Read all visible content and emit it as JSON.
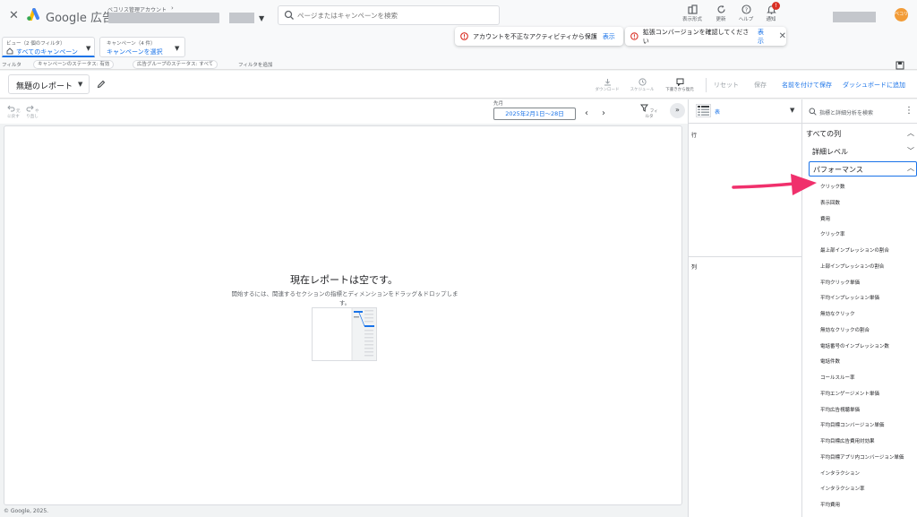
{
  "topbar": {
    "brand": "Google 広告",
    "account_label": "ベコリス管理アカウント",
    "search_placeholder": "ページまたはキャンペーンを検索",
    "tools": {
      "view_mode": "表示形式",
      "refresh": "更新",
      "help": "ヘルプ",
      "notifications": "通知",
      "notification_count": "!"
    },
    "avatar_text": "ベコリス"
  },
  "view_selector": {
    "small": "ビュー（2 個のフィルタ）",
    "main": "すべてのキャンペーン"
  },
  "campaign_selector": {
    "small": "キャンペーン（4 件）",
    "main": "キャンペーンを選択"
  },
  "toasts": [
    {
      "text": "アカウントを不正なアクティビティから保護",
      "link": "表示"
    },
    {
      "text": "拡張コンバージョンを確認してください",
      "link": "表示"
    }
  ],
  "filters": {
    "label": "フィルタ",
    "chips": [
      "キャンペーンのステータス: 有効",
      "広告グループのステータス: すべて"
    ],
    "add": "フィルタを追加"
  },
  "report": {
    "title": "無題のレポート",
    "tools": [
      "ダウンロード",
      "スケジュール",
      "下書きから復元"
    ],
    "reset": "リセット",
    "save": "保存",
    "save_as": "名前を付けて保存",
    "add_to_dashboard": "ダッシュボードに追加"
  },
  "canvas_toolbar": {
    "undo": "元に戻す",
    "redo": "やり直し",
    "period_label": "先月",
    "date_range": "2025年2月1日〜28日",
    "filter": "フィルタ"
  },
  "canvas": {
    "empty_title": "現在レポートは空です。",
    "empty_desc": "開始するには、関連するセクションの指標とディメンションをドラッグ＆ドロップします。"
  },
  "footer": "© Google, 2025.",
  "mid_panel": {
    "visualization": "表",
    "rows_label": "行",
    "columns_label": "列"
  },
  "right_panel": {
    "search_placeholder": "指標と詳細分析を検索",
    "sections": {
      "all_columns": "すべての列",
      "detail_level": "詳細レベル",
      "performance": "パフォーマンス"
    },
    "metrics": [
      "クリック数",
      "表示回数",
      "費用",
      "クリック率",
      "最上部インプレッションの割合",
      "上部インプレッションの割合",
      "平均クリック単価",
      "平均インプレッション単価",
      "無効なクリック",
      "無効なクリックの割合",
      "電話番号のインプレッション数",
      "電話件数",
      "コールスルー率",
      "平均エンゲージメント単価",
      "平均広告視聴単価",
      "平均目標コンバージョン単価",
      "平均目標広告費用対効果",
      "平均目標アプリ内コンバージョン単価",
      "インタラクション",
      "インタラクション率",
      "平均費用"
    ]
  },
  "colors": {
    "accent": "#1a73e8",
    "annotation_arrow": "#f0306c",
    "error": "#d93025"
  }
}
